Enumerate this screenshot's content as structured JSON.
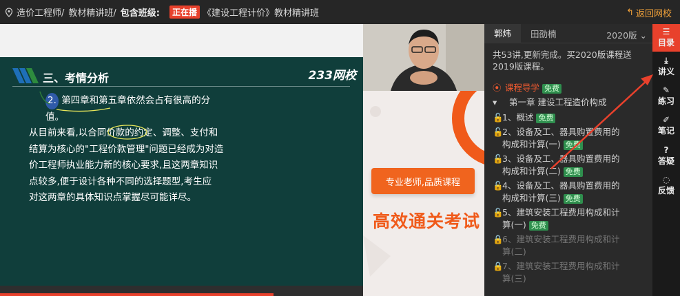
{
  "topbar": {
    "crumbs": [
      "造价工程师/",
      "教材精讲班/"
    ],
    "class_label": "包含班级:",
    "live_badge": "正在播",
    "course": "《建设工程计价》教材精讲班",
    "back_label": "返回网校",
    "back_icon": "arrow-back-icon"
  },
  "slide": {
    "section_title": "三、考情分析",
    "logo": "233网校",
    "num": "2.",
    "lines": [
      "第四章和第五章依然会占有很高的分值。",
      "从目前来看,以合同价款的约定、调整、支付和",
      "结算为核心的\"工程价款管理\"问题已经成为对造",
      "价工程师执业能力新的核心要求,且这两章知识",
      "点较多,便于设计各种不同的选择题型,考生应",
      "对这两章的具体知识点掌握尽可能详尽。"
    ]
  },
  "ad": {
    "button_text": "专业老师,品质课程",
    "big_text": "高效通关考试"
  },
  "panel": {
    "tabs": [
      "郭炜",
      "田劭楠"
    ],
    "year_select": "2020版",
    "notice": "共53讲,更新完成。买2020版课程送2019版课程。",
    "guide": "课程导学",
    "free_tag": "免费",
    "chapter": "第一章 建设工程造价构成",
    "items": [
      {
        "l1": "1、概述",
        "l2": "",
        "free": true,
        "locked": false
      },
      {
        "l1": "2、设备及工、器具购置费用的",
        "l2": "构成和计算(一)",
        "free": true,
        "locked": false
      },
      {
        "l1": "3、设备及工、器具购置费用的",
        "l2": "构成和计算(二)",
        "free": true,
        "locked": false
      },
      {
        "l1": "4、设备及工、器具购置费用的",
        "l2": "构成和计算(三)",
        "free": true,
        "locked": false
      },
      {
        "l1": "5、建筑安装工程费用构成和计",
        "l2": "算(一)",
        "free": true,
        "locked": false
      },
      {
        "l1": "6、建筑安装工程费用构成和计",
        "l2": "算(二)",
        "free": false,
        "locked": true
      },
      {
        "l1": "7、建筑安装工程费用构成和计",
        "l2": "算(三)",
        "free": false,
        "locked": true
      }
    ]
  },
  "side": [
    {
      "icon": "list-icon",
      "label": "目录"
    },
    {
      "icon": "download-icon",
      "label": "讲义"
    },
    {
      "icon": "pen-icon",
      "label": "练习"
    },
    {
      "icon": "note-icon",
      "label": "笔记"
    },
    {
      "icon": "question-icon",
      "label": "答疑"
    },
    {
      "icon": "feedback-icon",
      "label": "反馈"
    }
  ],
  "colors": {
    "accent": "#e8412c",
    "slide_bg": "#103e3b",
    "free_green": "#2f8f4e"
  }
}
